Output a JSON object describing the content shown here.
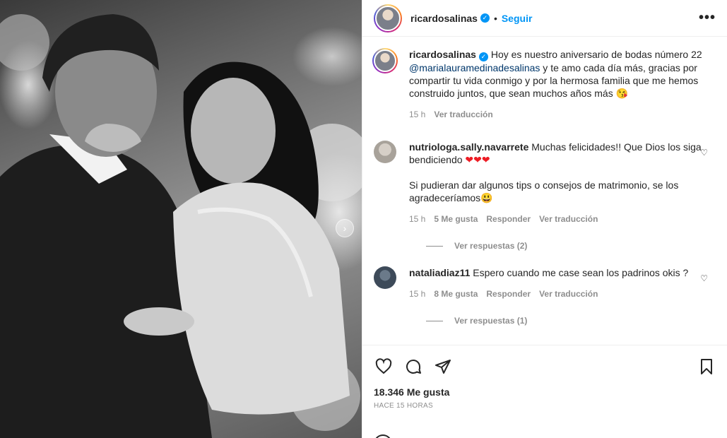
{
  "post": {
    "username": "ricardosalinas",
    "follow_label": "Seguir",
    "separator": "•",
    "more_label": "•••"
  },
  "caption": {
    "username": "ricardosalinas",
    "text_part1": " Hoy es nuestro aniversario de bodas número 22 ",
    "mention": "@marialauramedinadesalinas",
    "text_part2": " y te amo cada día más, gracias por compartir tu vida conmigo y por la hermosa familia que me hemos construido juntos, que sean muchos años más ",
    "emoji": "😘",
    "time": "15 h",
    "translate": "Ver traducción"
  },
  "comments": [
    {
      "username": "nutriologa.sally.navarrete",
      "text_part1": " Muchas felicidades!! Que Dios los siga bendiciendo ",
      "emoji1": "❤❤❤",
      "text_part2": "Si pudieran dar algunos tips o consejos de matrimonio, se los agradeceríamos",
      "emoji2": "😃",
      "time": "15 h",
      "likes": "5 Me gusta",
      "reply": "Responder",
      "translate": "Ver traducción",
      "view_replies": "Ver respuestas (2)"
    },
    {
      "username": "nataliadiaz11",
      "text_part1": " Espero cuando me case sean los padrinos okis ?",
      "time": "15 h",
      "likes": "8 Me gusta",
      "reply": "Responder",
      "translate": "Ver traducción",
      "view_replies": "Ver respuestas (1)"
    }
  ],
  "footer": {
    "likes": "18.346 Me gusta",
    "timestamp": "HACE 15 HORAS"
  },
  "icons": {
    "like": "heart-icon",
    "comment": "comment-icon",
    "share": "share-icon",
    "save": "bookmark-icon"
  }
}
